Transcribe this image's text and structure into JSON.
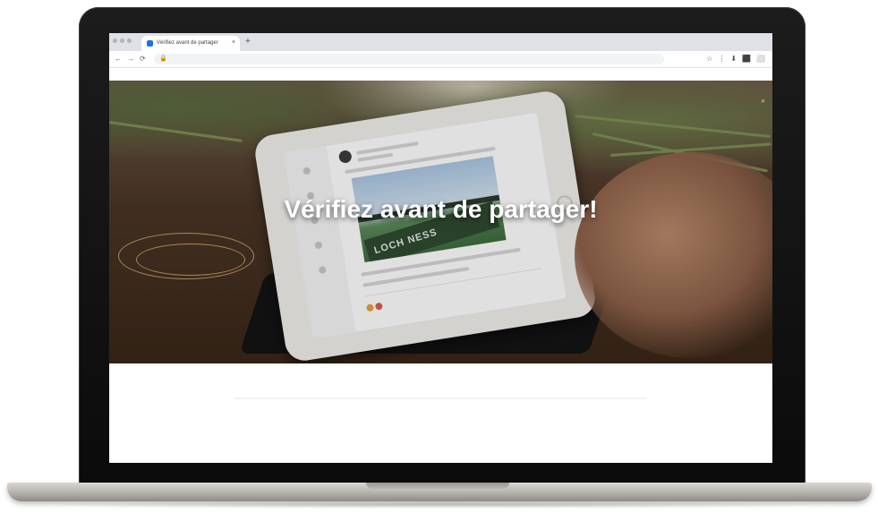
{
  "browser": {
    "tab_title": "Vérifiez avant de partager",
    "tab_close": "×",
    "new_tab": "+",
    "back": "←",
    "forward": "→",
    "reload": "⟳",
    "lock": "🔒",
    "url": "",
    "extensions": [
      "☆",
      "⋮",
      "⬇",
      "⬛",
      "⬜"
    ],
    "bookmark": ""
  },
  "hero": {
    "title": "Vérifiez avant de partager!",
    "nav": [
      "",
      "",
      ""
    ],
    "search": "⌕",
    "tablet_banner": "LOCH NESS"
  },
  "article": {
    "paragraph_1": "",
    "paragraph_2": ""
  },
  "colors": {
    "tab_strip": "#dee1e6",
    "accent": "#1a73e8",
    "hero_text": "#ffffff",
    "laptop_bezel": "#111111",
    "laptop_base": "#c9c5c0"
  }
}
